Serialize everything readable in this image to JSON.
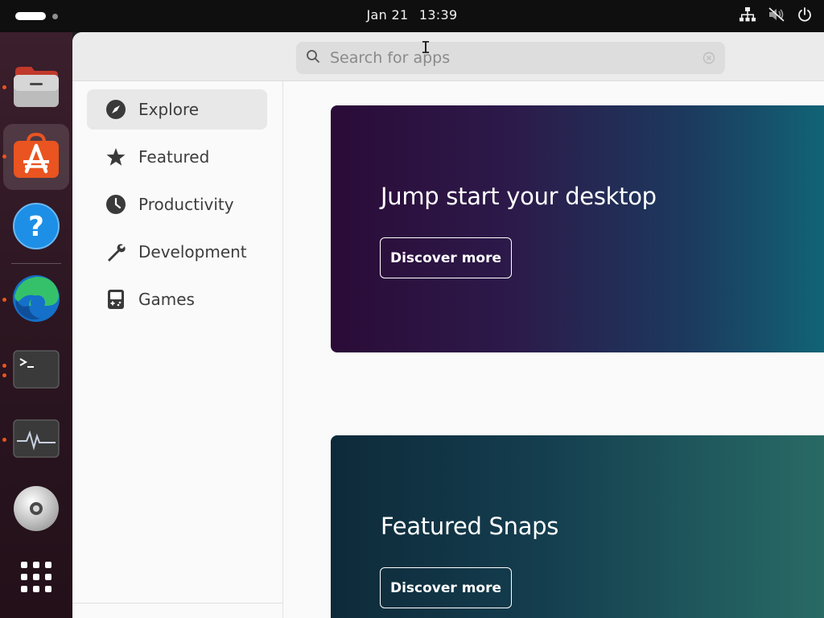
{
  "topbar": {
    "date": "Jan 21",
    "time": "13:39",
    "tray_icons": [
      "network-icon",
      "volume-muted-icon",
      "power-icon"
    ]
  },
  "dock": {
    "apps": [
      {
        "name": "files-icon",
        "running": true,
        "active": false
      },
      {
        "name": "app-center-icon",
        "running": true,
        "active": true
      },
      {
        "name": "help-icon",
        "running": false,
        "active": false
      },
      {
        "name": "edge-browser-icon",
        "running": true,
        "active": false
      },
      {
        "name": "terminal-icon",
        "running": true,
        "active": false
      },
      {
        "name": "system-monitor-icon",
        "running": true,
        "active": false
      },
      {
        "name": "disc-icon",
        "running": false,
        "active": false
      },
      {
        "name": "show-apps-icon",
        "running": false,
        "active": false
      }
    ]
  },
  "header": {
    "search_placeholder": "Search for apps"
  },
  "sidebar": {
    "items": [
      {
        "label": "Explore",
        "icon": "compass-icon",
        "selected": true
      },
      {
        "label": "Featured",
        "icon": "star-icon",
        "selected": false
      },
      {
        "label": "Productivity",
        "icon": "clock-icon",
        "selected": false
      },
      {
        "label": "Development",
        "icon": "wrench-icon",
        "selected": false
      },
      {
        "label": "Games",
        "icon": "gamepad-icon",
        "selected": false
      }
    ]
  },
  "main": {
    "banners": [
      {
        "title": "Jump start your desktop",
        "button_label": "Discover more"
      },
      {
        "title": "Featured Snaps",
        "button_label": "Discover more"
      }
    ]
  },
  "colors": {
    "accent": "#e95420",
    "banner1_start": "#2b0b37",
    "banner1_end": "#0f6a7a",
    "banner2_start": "#0e2a3a",
    "banner2_end": "#2b6d66"
  }
}
